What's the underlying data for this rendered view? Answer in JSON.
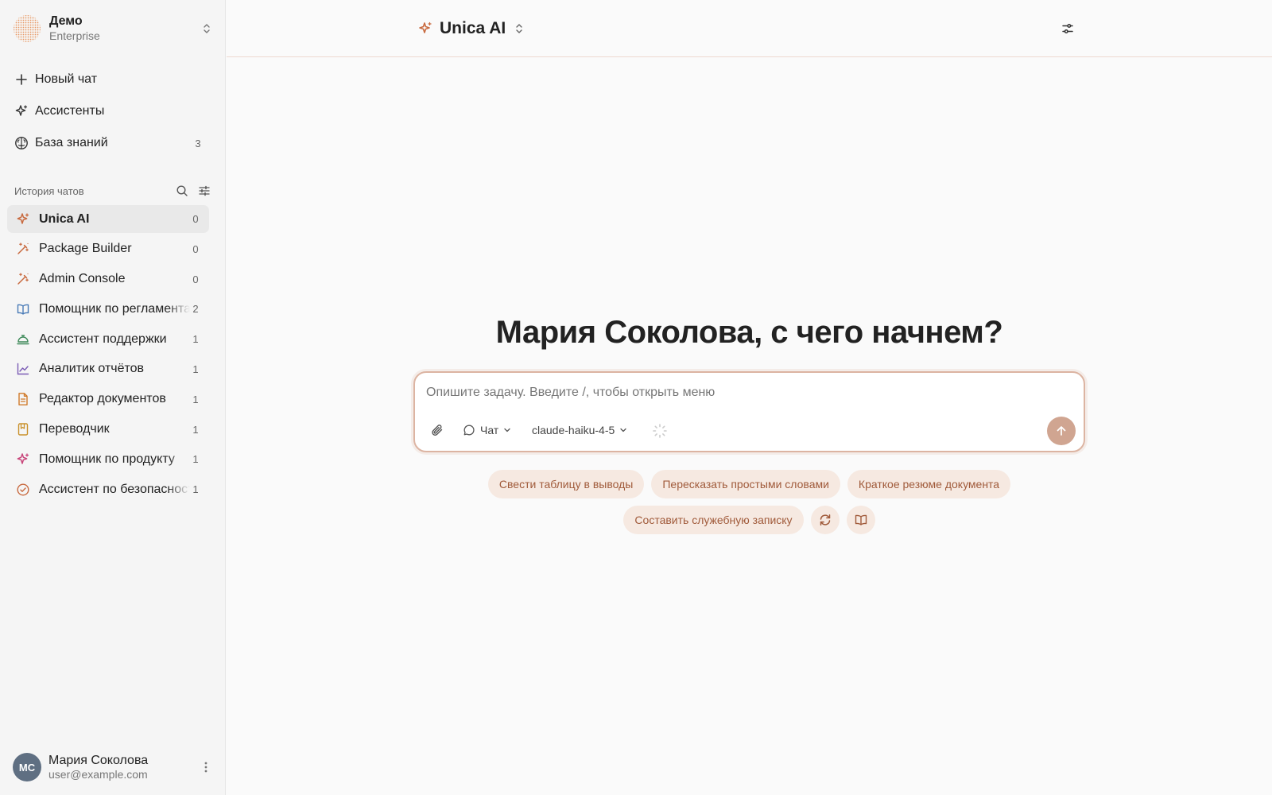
{
  "workspace": {
    "name": "Демо",
    "plan": "Enterprise"
  },
  "nav": [
    {
      "label": "Новый чат",
      "count": ""
    },
    {
      "label": "Ассистенты",
      "count": ""
    },
    {
      "label": "База знаний",
      "count": "3"
    }
  ],
  "history": {
    "title": "История чатов",
    "items": [
      {
        "label": "Unica AI",
        "count": "0",
        "icon": "sparkles-icon",
        "color": "#c8693e"
      },
      {
        "label": "Package Builder",
        "count": "0",
        "icon": "magic-wand-icon",
        "color": "#c8693e"
      },
      {
        "label": "Admin Console",
        "count": "0",
        "icon": "magic-wand-icon",
        "color": "#c8693e"
      },
      {
        "label": "Помощник по регламентам",
        "count": "2",
        "icon": "book-open-icon",
        "color": "#4a7bb7"
      },
      {
        "label": "Ассистент поддержки",
        "count": "1",
        "icon": "concierge-bell-icon",
        "color": "#3f8a5a"
      },
      {
        "label": "Аналитик отчётов",
        "count": "1",
        "icon": "line-chart-icon",
        "color": "#7b5cb5"
      },
      {
        "label": "Редактор документов",
        "count": "1",
        "icon": "document-icon",
        "color": "#d07a2a"
      },
      {
        "label": "Переводчик",
        "count": "1",
        "icon": "book-icon",
        "color": "#c9912b"
      },
      {
        "label": "Помощник по продукту",
        "count": "1",
        "icon": "sparkles-icon",
        "color": "#c8457a"
      },
      {
        "label": "Ассистент по безопасности",
        "count": "1",
        "icon": "check-circle-icon",
        "color": "#c8693e"
      }
    ]
  },
  "user": {
    "initials": "МС",
    "name": "Мария Соколова",
    "email": "user@example.com"
  },
  "header": {
    "model_title": "Unica AI"
  },
  "main": {
    "greeting": "Мария Соколова, с чего начнем?",
    "composer": {
      "placeholder": "Опишите задачу. Введите /, чтобы открыть меню",
      "mode": "Чат",
      "model": "claude-haiku-4-5"
    },
    "suggestions_row1": [
      "Свести таблицу в выводы",
      "Пересказать простыми словами",
      "Краткое резюме документа"
    ],
    "suggestions_row2": [
      "Составить служебную записку"
    ]
  },
  "colors": {
    "accent": "#c8693e",
    "chip_bg": "#f6e9e1",
    "chip_text": "#a05a3a",
    "send_bg": "#d0a591"
  }
}
